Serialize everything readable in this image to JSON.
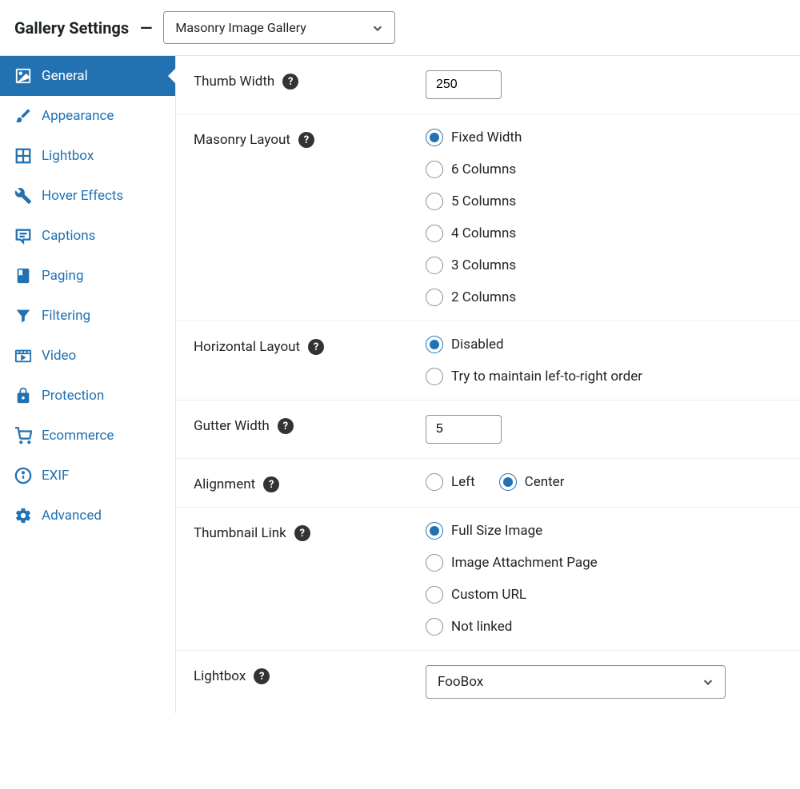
{
  "header": {
    "title": "Gallery Settings",
    "dash": "—",
    "template_selected": "Masonry Image Gallery"
  },
  "sidebar": {
    "items": [
      {
        "label": "General",
        "active": true
      },
      {
        "label": "Appearance",
        "active": false
      },
      {
        "label": "Lightbox",
        "active": false
      },
      {
        "label": "Hover Effects",
        "active": false
      },
      {
        "label": "Captions",
        "active": false
      },
      {
        "label": "Paging",
        "active": false
      },
      {
        "label": "Filtering",
        "active": false
      },
      {
        "label": "Video",
        "active": false
      },
      {
        "label": "Protection",
        "active": false
      },
      {
        "label": "Ecommerce",
        "active": false
      },
      {
        "label": "EXIF",
        "active": false
      },
      {
        "label": "Advanced",
        "active": false
      }
    ]
  },
  "fields": {
    "thumb_width": {
      "label": "Thumb Width",
      "value": "250"
    },
    "masonry_layout": {
      "label": "Masonry Layout",
      "options": [
        "Fixed Width",
        "6 Columns",
        "5 Columns",
        "4 Columns",
        "3 Columns",
        "2 Columns"
      ],
      "selected": "Fixed Width"
    },
    "horizontal_layout": {
      "label": "Horizontal Layout",
      "options": [
        "Disabled",
        "Try to maintain lef-to-right order"
      ],
      "selected": "Disabled"
    },
    "gutter_width": {
      "label": "Gutter Width",
      "value": "5"
    },
    "alignment": {
      "label": "Alignment",
      "options": [
        "Left",
        "Center"
      ],
      "selected": "Center"
    },
    "thumbnail_link": {
      "label": "Thumbnail Link",
      "options": [
        "Full Size Image",
        "Image Attachment Page",
        "Custom URL",
        "Not linked"
      ],
      "selected": "Full Size Image"
    },
    "lightbox": {
      "label": "Lightbox",
      "selected": "FooBox"
    }
  }
}
